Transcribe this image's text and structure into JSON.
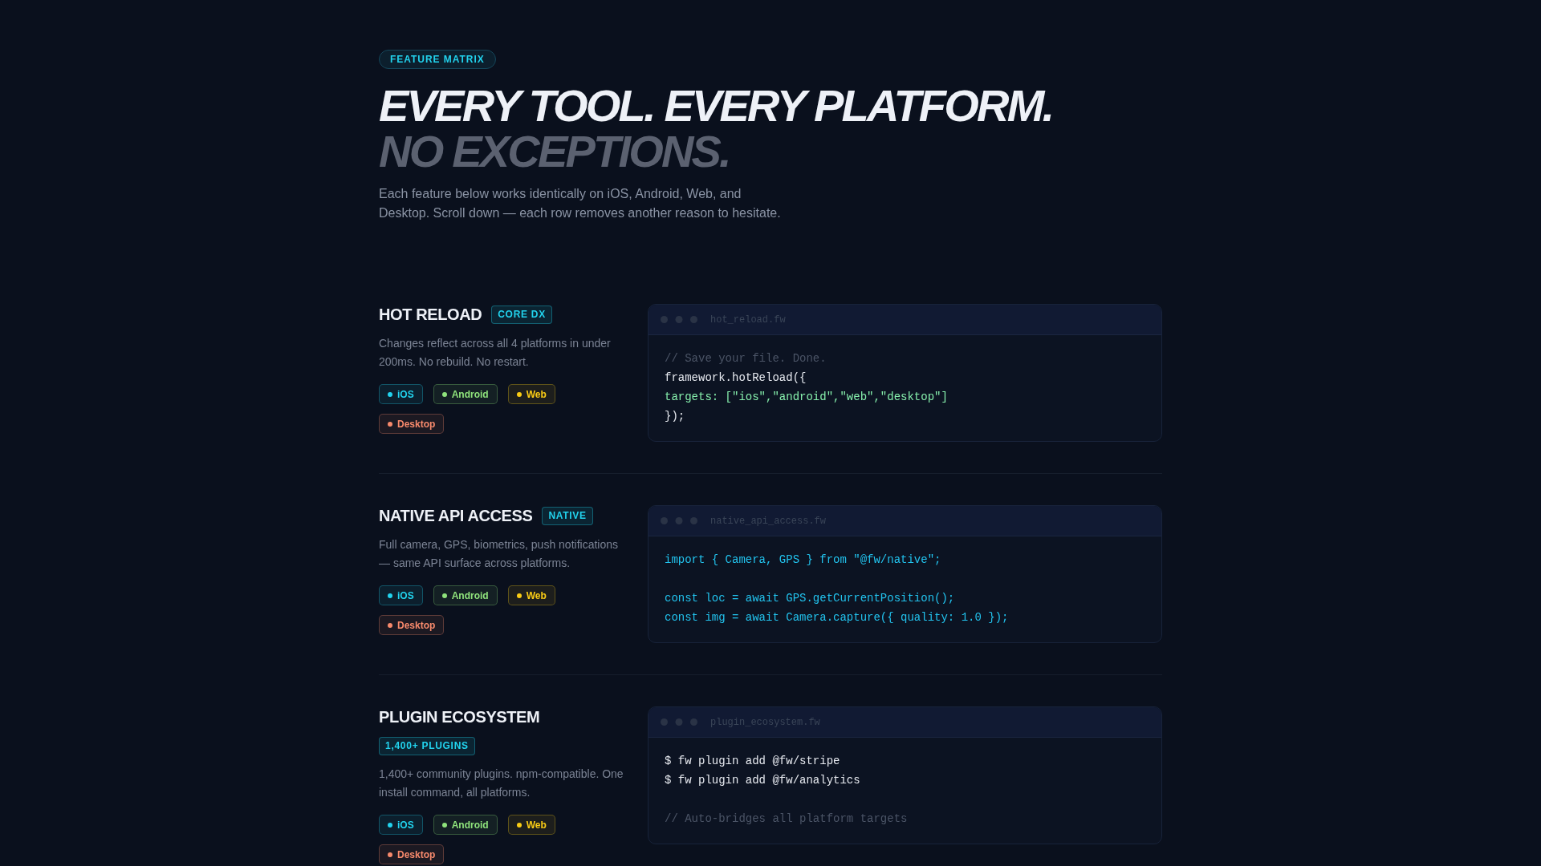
{
  "header": {
    "badge": "FEATURE MATRIX",
    "headline": "EVERY TOOL. EVERY PLATFORM.",
    "headline_accent": "NO EXCEPTIONS.",
    "intro": "Each feature below works identically on iOS, Android, Web, and Desktop. Scroll down — each row removes another reason to hesitate."
  },
  "features": [
    {
      "title": "HOT RELOAD",
      "tag": "CORE DX",
      "description": "Changes reflect across all 4 platforms in under 200ms. No rebuild. No restart.",
      "platforms": [
        {
          "label": "iOS",
          "color": "#22d3ee"
        },
        {
          "label": "Android",
          "color": "#8fe37c"
        },
        {
          "label": "Web",
          "color": "#facc15"
        },
        {
          "label": "Desktop",
          "color": "#f88a6c"
        }
      ],
      "code": {
        "filename": "hot_reload.fw",
        "lines": [
          {
            "kind": "comment",
            "text": "// Save your file. Done."
          },
          {
            "kind": "code",
            "text": "framework.hotReload({"
          },
          {
            "kind": "string",
            "text": "targets: [\"ios\",\"android\",\"web\",\"desktop\"]"
          },
          {
            "kind": "code",
            "text": "});"
          }
        ]
      }
    },
    {
      "title": "NATIVE API ACCESS",
      "tag": "NATIVE",
      "description": "Full camera, GPS, biometrics, push notifications — same API surface across platforms.",
      "platforms": [
        {
          "label": "iOS",
          "color": "#22d3ee"
        },
        {
          "label": "Android",
          "color": "#8fe37c"
        },
        {
          "label": "Web",
          "color": "#facc15"
        },
        {
          "label": "Desktop",
          "color": "#f88a6c"
        }
      ],
      "code": {
        "filename": "native_api_access.fw",
        "lines": [
          {
            "kind": "accent",
            "text": "import { Camera, GPS } from \"@fw/native\";"
          },
          {
            "kind": "blank"
          },
          {
            "kind": "accent",
            "text": "const loc = await GPS.getCurrentPosition();"
          },
          {
            "kind": "accent",
            "text": "const img = await Camera.capture({ quality: 1.0 });"
          }
        ]
      }
    },
    {
      "title": "PLUGIN ECOSYSTEM",
      "tag": "1,400+ PLUGINS",
      "description": "1,400+ community plugins. npm-compatible. One install command, all platforms.",
      "platforms": [
        {
          "label": "iOS",
          "color": "#22d3ee"
        },
        {
          "label": "Android",
          "color": "#8fe37c"
        },
        {
          "label": "Web",
          "color": "#facc15"
        },
        {
          "label": "Desktop",
          "color": "#f88a6c"
        }
      ],
      "code": {
        "filename": "plugin_ecosystem.fw",
        "lines": [
          {
            "kind": "code",
            "text": "$ fw plugin add @fw/stripe"
          },
          {
            "kind": "code",
            "text": "$ fw plugin add @fw/analytics"
          },
          {
            "kind": "blank"
          },
          {
            "kind": "comment",
            "text": "// Auto-bridges all platform targets"
          }
        ]
      }
    }
  ]
}
